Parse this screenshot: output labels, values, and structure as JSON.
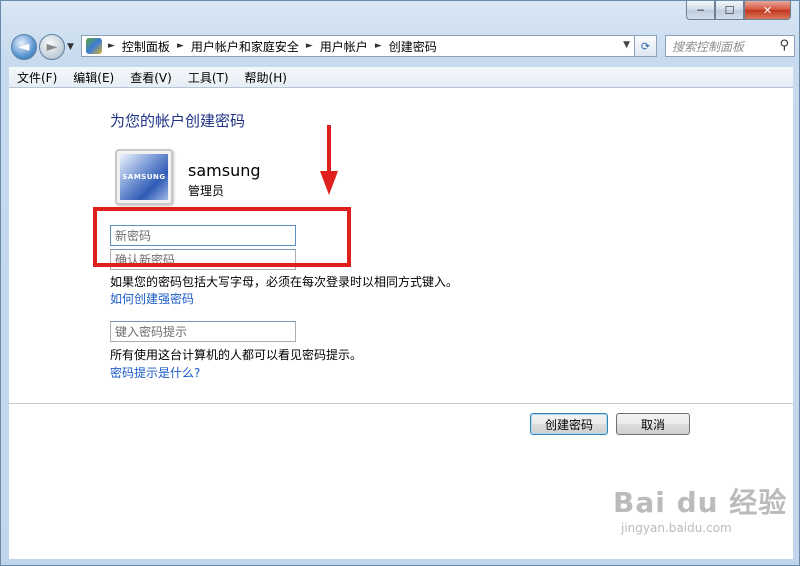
{
  "window": {
    "caption": {
      "minimize": "─",
      "maximize": "☐",
      "close": "✕"
    }
  },
  "nav": {
    "back_glyph": "◄",
    "forward_glyph": "►",
    "breadcrumbs": [
      "控制面板",
      "用户帐户和家庭安全",
      "用户帐户",
      "创建密码"
    ],
    "search_placeholder": "搜索控制面板"
  },
  "menubar": {
    "items": [
      "文件(F)",
      "编辑(E)",
      "查看(V)",
      "工具(T)",
      "帮助(H)"
    ]
  },
  "page": {
    "heading": "为您的帐户创建密码",
    "avatar_text": "SAMSUNG",
    "username": "samsung",
    "account_type": "管理员",
    "new_password_placeholder": "新密码",
    "confirm_password_placeholder": "确认新密码",
    "caps_note": "如果您的密码包括大写字母，必须在每次登录时以相同方式键入。",
    "strong_password_link": "如何创建强密码",
    "hint_placeholder": "键入密码提示",
    "hint_note": "所有使用这台计算机的人都可以看见密码提示。",
    "hint_link": "密码提示是什么?",
    "create_button": "创建密码",
    "cancel_button": "取消"
  },
  "annotation": {
    "color": "#e0201d"
  },
  "watermark": {
    "main": "Bai du 经验",
    "sub": "jingyan.baidu.com"
  },
  "colors": {
    "heading": "#1e3287",
    "link": "#1a5bc8"
  }
}
